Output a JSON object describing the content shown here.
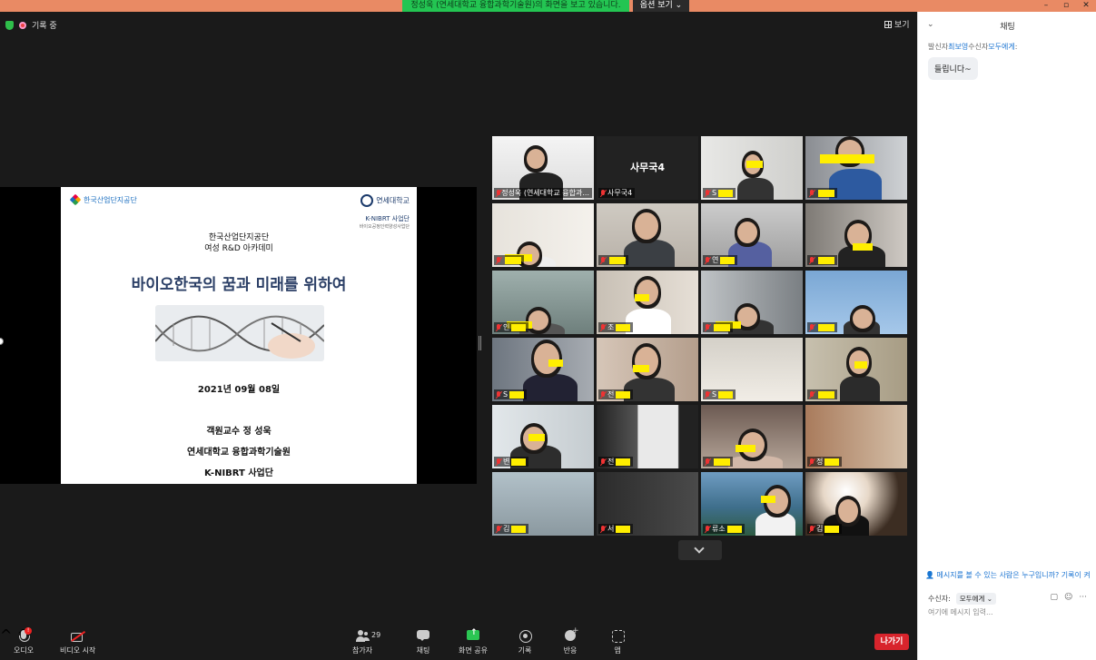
{
  "window": {
    "share_banner": "정성욱 (연세대학교 융합과학기술원)의 화면을 보고 있습니다.",
    "view_options": "옵션 보기 ⌄"
  },
  "meeting": {
    "recording_label": "기록 중",
    "view_label": "보기"
  },
  "slide": {
    "org_logo": "한국산업단지공단",
    "univ_logo": "연세대학교",
    "program_badge": "K-NIBRT 사업단",
    "program_badge_sub": "바이오공정인력양성사업단",
    "org_line1": "한국산업단지공단",
    "org_line2": "여성 R&D 아카데미",
    "title": "바이오한국의 꿈과 미래를 위하여",
    "date": "2021년 09월 08일",
    "presenter_line1": "객원교수 정 성욱",
    "presenter_line2": "연세대학교 융합과학기술원",
    "presenter_line3": "K-NIBRT 사업단"
  },
  "participants": [
    {
      "name": "정성욱 (연세대학교 융합과...",
      "active": true
    },
    {
      "name": "사무국4",
      "label": "사무국4"
    },
    {
      "name": "S"
    },
    {
      "name": ""
    },
    {
      "name": ""
    },
    {
      "name": ""
    },
    {
      "name": "연"
    },
    {
      "name": ""
    },
    {
      "name": "인"
    },
    {
      "name": "조"
    },
    {
      "name": ""
    },
    {
      "name": ""
    },
    {
      "name": "S"
    },
    {
      "name": "전"
    },
    {
      "name": "S"
    },
    {
      "name": ""
    },
    {
      "name": "변"
    },
    {
      "name": "전"
    },
    {
      "name": ""
    },
    {
      "name": "정"
    },
    {
      "name": "김"
    },
    {
      "name": "서"
    },
    {
      "name": "류소"
    },
    {
      "name": "김"
    }
  ],
  "toolbar": {
    "audio": "오디오",
    "audio_badge": "!",
    "video": "비디오 시작",
    "participants": "참가자",
    "participants_count": "29",
    "chat": "채팅",
    "share": "화면 공유",
    "record": "기록",
    "reactions": "반응",
    "apps": "앱",
    "leave": "나가기"
  },
  "chat": {
    "title": "채팅",
    "from_label": "발신자",
    "from_name": "최보영",
    "to_label": "수신자",
    "to_name": "모두에게",
    "message": "들립니다~",
    "privacy": "메시지를 볼 수 있는 사람은 누구입니까? 기록이 켜",
    "recipient_label": "수신자:",
    "recipient_value": "모두에게 ⌄",
    "input_placeholder": "여기에 메시지 입력..."
  },
  "colors": {
    "banner_green": "#23c552",
    "leave_red": "#d8242c",
    "active_border": "#d7e65a",
    "accent_blue": "#1a73d1"
  }
}
